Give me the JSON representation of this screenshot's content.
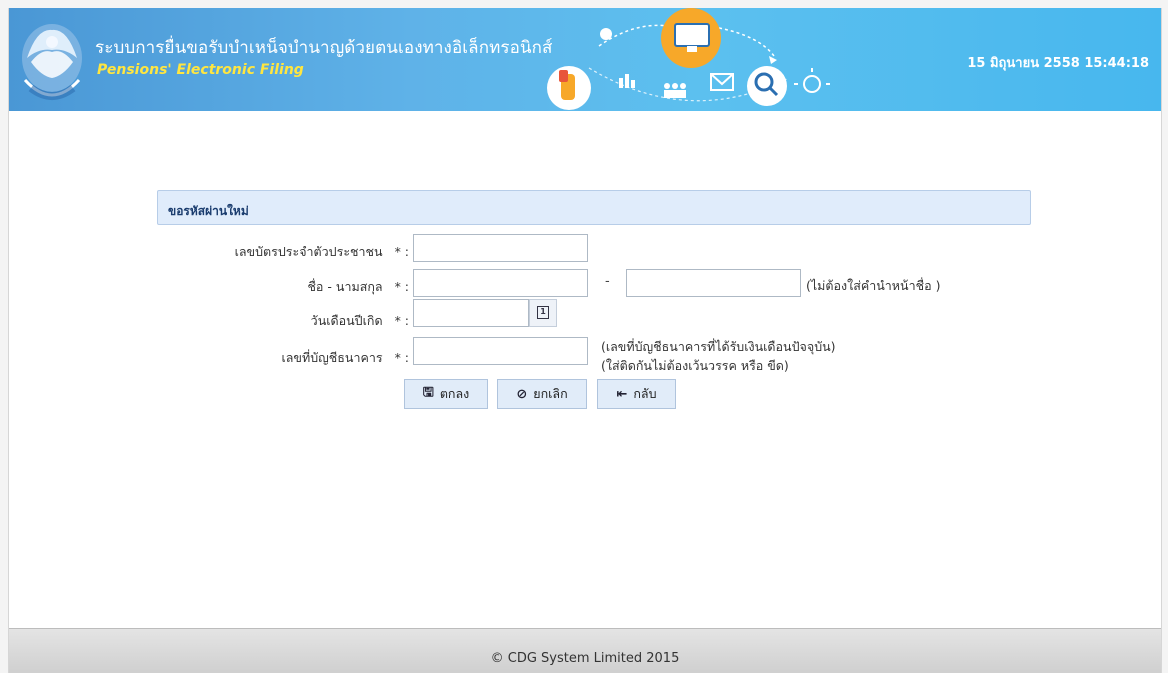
{
  "header": {
    "title_th": "ระบบการยื่นขอรับบำเหน็จบำนาญด้วยตนเองทางอิเล็กทรอนิกส์",
    "title_en": "Pensions' Electronic Filing",
    "datetime": "15 มิถุนายน 2558 15:44:18",
    "logo_icon": "department-seal-icon",
    "colors": {
      "header_start": "#4a97d5",
      "header_end": "#47b7ee",
      "subtitle": "#ffe640"
    }
  },
  "form": {
    "section_title": "ขอรหัสผ่านใหม่",
    "id_card_label": "เลขบัตรประจำตัวประชาชน",
    "name_label": "ชื่อ - นามสกุล",
    "name_separator": "-",
    "name_note": "(ไม่ต้องใส่คำนำหน้าชื่อ )",
    "birthdate_label": "วันเดือนปีเกิด",
    "account_label": "เลขที่บัญชีธนาคาร",
    "account_note_1": "(เลขที่บัญชีธนาคารที่ได้รับเงินเดือนปัจจุบัน)",
    "account_note_2": "(ใส่ติดกันไม่ต้องเว้นวรรค หรือ ขีด)",
    "required_mark": "* :",
    "values": {
      "id_card": "",
      "first_name": "",
      "last_name": "",
      "birthdate": "",
      "account": ""
    }
  },
  "buttons": {
    "ok_label": "ตกลง",
    "cancel_label": "ยกเลิก",
    "back_label": "กลับ"
  },
  "footer": {
    "copyright": "© CDG System Limited 2015"
  }
}
